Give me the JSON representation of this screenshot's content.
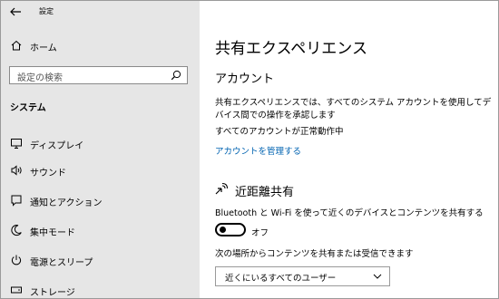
{
  "app": {
    "title": "設定"
  },
  "sidebar": {
    "home_label": "ホーム",
    "search_placeholder": "設定の検索",
    "section_label": "システム",
    "items": [
      {
        "label": "ディスプレイ",
        "icon": "display-icon"
      },
      {
        "label": "サウンド",
        "icon": "speaker-icon"
      },
      {
        "label": "通知とアクション",
        "icon": "notification-icon"
      },
      {
        "label": "集中モード",
        "icon": "moon-icon"
      },
      {
        "label": "電源とスリープ",
        "icon": "power-icon"
      },
      {
        "label": "ストレージ",
        "icon": "storage-icon"
      }
    ]
  },
  "main": {
    "title": "共有エクスペリエンス",
    "accounts": {
      "heading": "アカウント",
      "description": "共有エクスペリエンスでは、すべてのシステム アカウントを使用してデバイス間での操作を承認します",
      "status": "すべてのアカウントが正常動作中",
      "manage_link": "アカウントを管理する"
    },
    "nearby": {
      "heading": "近距離共有",
      "description": "Bluetooth と Wi-Fi を使って近くのデバイスとコンテンツを共有する",
      "toggle_state": "オフ",
      "receive_label": "次の場所からコンテンツを共有または受信できます",
      "receive_value": "近くにいるすべてのユーザー"
    }
  }
}
